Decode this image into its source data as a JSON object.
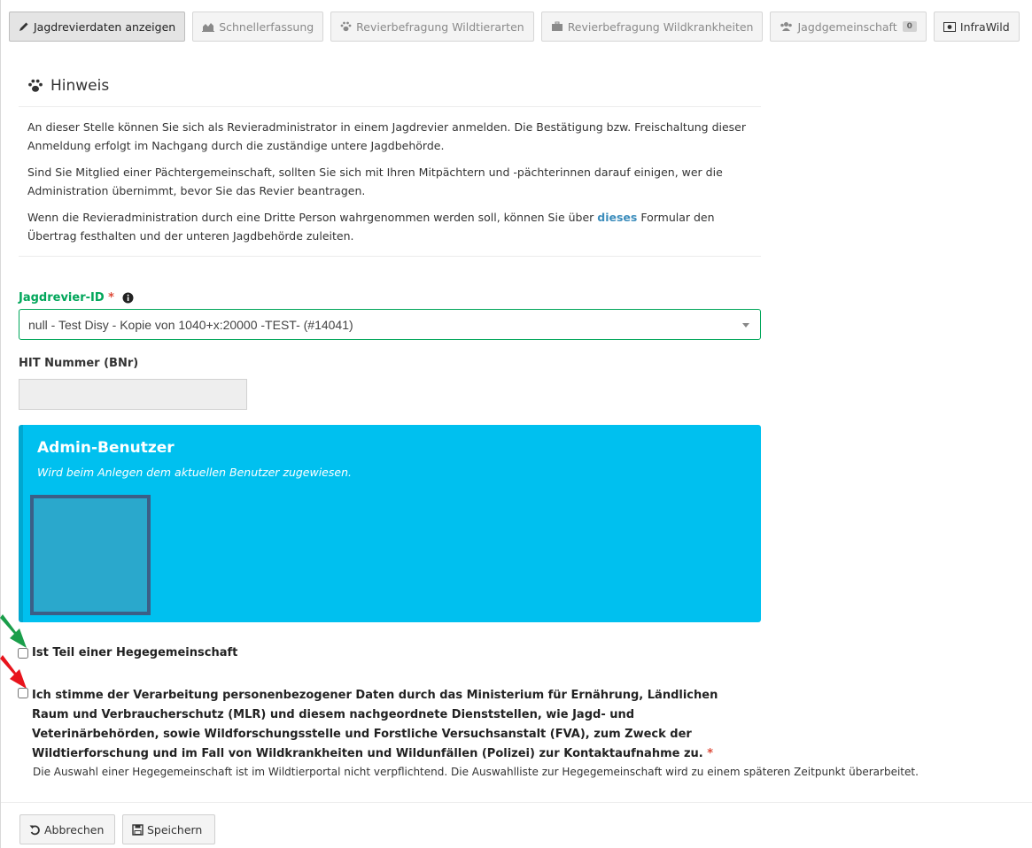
{
  "tabs": [
    {
      "label": "Jagdrevierdaten anzeigen",
      "icon": "pencil-icon",
      "active": true
    },
    {
      "label": "Schnellerfassung",
      "icon": "area-chart-icon"
    },
    {
      "label": "Revierbefragung Wildtierarten",
      "icon": "paw-icon"
    },
    {
      "label": "Revierbefragung Wildkrankheiten",
      "icon": "briefcase-icon"
    },
    {
      "label": "Jagdgemeinschaft",
      "icon": "users-icon",
      "badge": "0"
    },
    {
      "label": "InfraWild",
      "icon": "money-icon"
    }
  ],
  "hinweis": {
    "title": "Hinweis",
    "p1": "An dieser Stelle können Sie sich als Revieradministrator in einem Jagdrevier anmelden. Die Bestätigung bzw. Freischaltung dieser Anmeldung erfolgt im Nachgang durch die zuständige untere Jagdbehörde.",
    "p2": "Sind Sie Mitglied einer Pächtergemeinschaft, sollten Sie sich mit Ihren Mitpächtern und -pächterinnen darauf einigen, wer die Administration übernimmt, bevor Sie das Revier beantragen.",
    "p3_before": "Wenn die Revieradministration durch eine Dritte Person wahrgenommen werden soll, können Sie über ",
    "p3_link": "dieses",
    "p3_after": " Formular den Übertrag festhalten und der unteren Jagdbehörde zuleiten."
  },
  "form": {
    "jagdrevier_label": "Jagdrevier-ID",
    "required_mark": "*",
    "jagdrevier_value": "null - Test Disy - Kopie von 1040+x:20000 -TEST- (#14041)",
    "hit_label": "HIT Nummer (BNr)",
    "hit_value": ""
  },
  "admin": {
    "title": "Admin-Benutzer",
    "subtitle": "Wird beim Anlegen dem aktuellen Benutzer zugewiesen."
  },
  "checkboxes": {
    "hege_label": "Ist Teil einer Hegegemeinschaft",
    "consent_label": "Ich stimme der Verarbeitung personenbezogener Daten durch das Ministerium für Ernährung, Ländlichen Raum und Verbraucherschutz (MLR) und diesem nachgeordnete Dienststellen, wie Jagd- und Veterinärbehörden, sowie Wildforschungsstelle und Forstliche Versuchsanstalt (FVA), zum Zweck der Wildtierforschung und im Fall von Wildkrankheiten und Wildunfällen (Polizei) zur Kontaktaufnahme zu."
  },
  "note": "Die Auswahl einer Hegegemeinschaft ist im Wildtierportal nicht verpflichtend. Die Auswahlliste zur Hegegemeinschaft wird zu einem späteren Zeitpunkt überarbeitet.",
  "buttons": {
    "cancel": "Abbrechen",
    "save": "Speichern"
  },
  "colors": {
    "success": "#00a65a",
    "info_box": "#00c0ef",
    "required": "#dd4b39",
    "link": "#3c8dbc",
    "arrow_green": "#1a9e4a",
    "arrow_red": "#e8141c"
  }
}
